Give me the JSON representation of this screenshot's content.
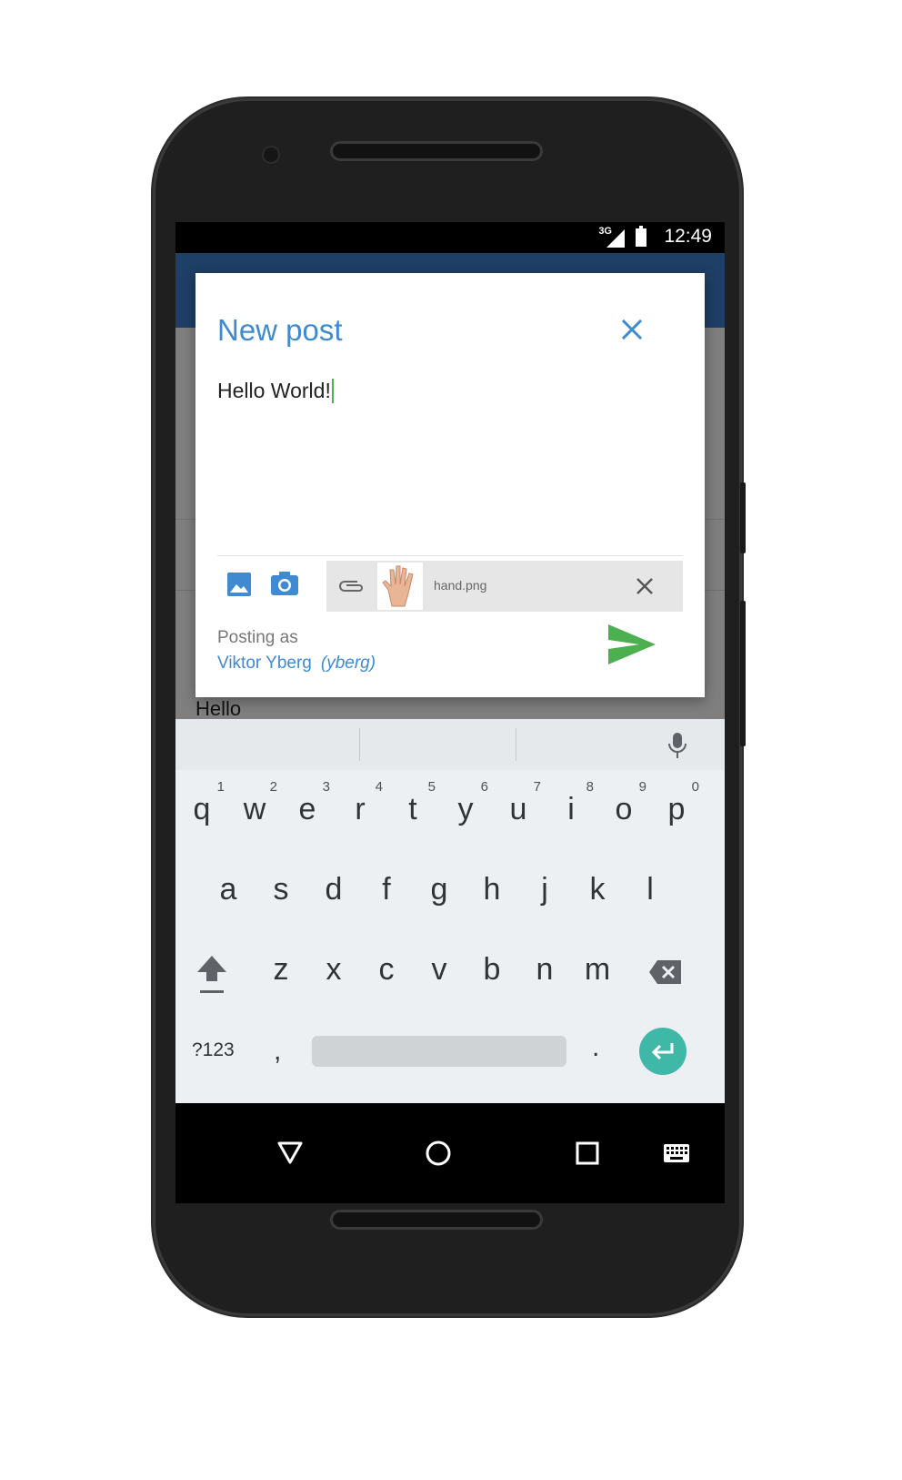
{
  "status_bar": {
    "network": "3G",
    "time": "12:49"
  },
  "dialog": {
    "title": "New post",
    "post_text": "Hello World!",
    "attachment": {
      "filename": "hand.png"
    },
    "posting_as_label": "Posting as",
    "user_name": "Viktor Yberg",
    "user_handle": "(yberg)"
  },
  "background": {
    "preview_text": "Hello"
  },
  "keyboard": {
    "row1": [
      {
        "key": "q",
        "hint": "1"
      },
      {
        "key": "w",
        "hint": "2"
      },
      {
        "key": "e",
        "hint": "3"
      },
      {
        "key": "r",
        "hint": "4"
      },
      {
        "key": "t",
        "hint": "5"
      },
      {
        "key": "y",
        "hint": "6"
      },
      {
        "key": "u",
        "hint": "7"
      },
      {
        "key": "i",
        "hint": "8"
      },
      {
        "key": "o",
        "hint": "9"
      },
      {
        "key": "p",
        "hint": "0"
      }
    ],
    "row2": [
      "a",
      "s",
      "d",
      "f",
      "g",
      "h",
      "j",
      "k",
      "l"
    ],
    "row3": [
      "z",
      "x",
      "c",
      "v",
      "b",
      "n",
      "m"
    ],
    "symbols_label": "?123",
    "comma": ",",
    "period": "."
  },
  "icons": {
    "close": "close-icon",
    "gallery": "image-icon",
    "camera": "camera-icon",
    "attachment": "paperclip-icon",
    "remove_attachment": "close-icon",
    "send": "send-icon",
    "mic": "microphone-icon",
    "shift": "shift-icon",
    "backspace": "backspace-icon",
    "enter": "enter-icon",
    "nav_back": "back-triangle-icon",
    "nav_home": "home-circle-icon",
    "nav_recents": "recents-square-icon",
    "nav_keyboard": "keyboard-icon"
  },
  "colors": {
    "accent_blue": "#3f8ad0",
    "send_green": "#4caf50",
    "app_bar": "#1e3f66",
    "enter_teal": "#3fb8a8"
  }
}
